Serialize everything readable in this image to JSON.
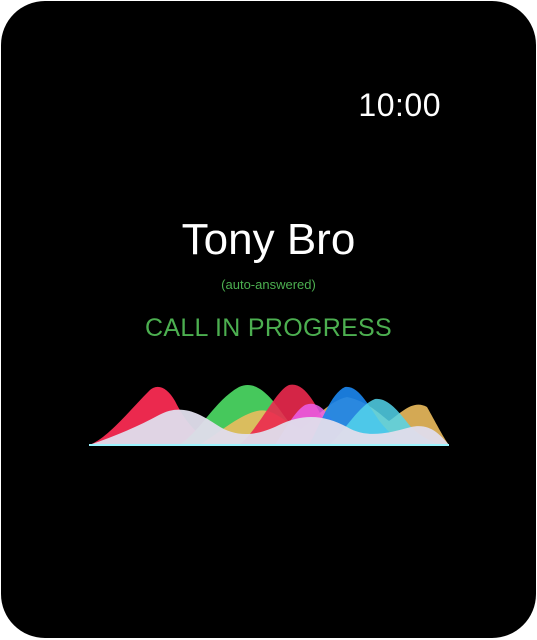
{
  "clock": {
    "time": "10:00"
  },
  "call": {
    "caller_name": "Tony Bro",
    "subtitle": "(auto-answered)",
    "status": "CALL IN PROGRESS"
  },
  "waveform": {
    "icon": "audio-waveform",
    "colors": {
      "red": "#ff2d55",
      "green": "#4cd964",
      "yellow": "#ffcc66",
      "magenta": "#ff66ff",
      "blue": "#1e90ff",
      "cyan": "#5ae6ff",
      "base": "#f3efff"
    }
  },
  "colors": {
    "background": "#000000",
    "accent": "#4caf50",
    "text": "#ffffff"
  }
}
